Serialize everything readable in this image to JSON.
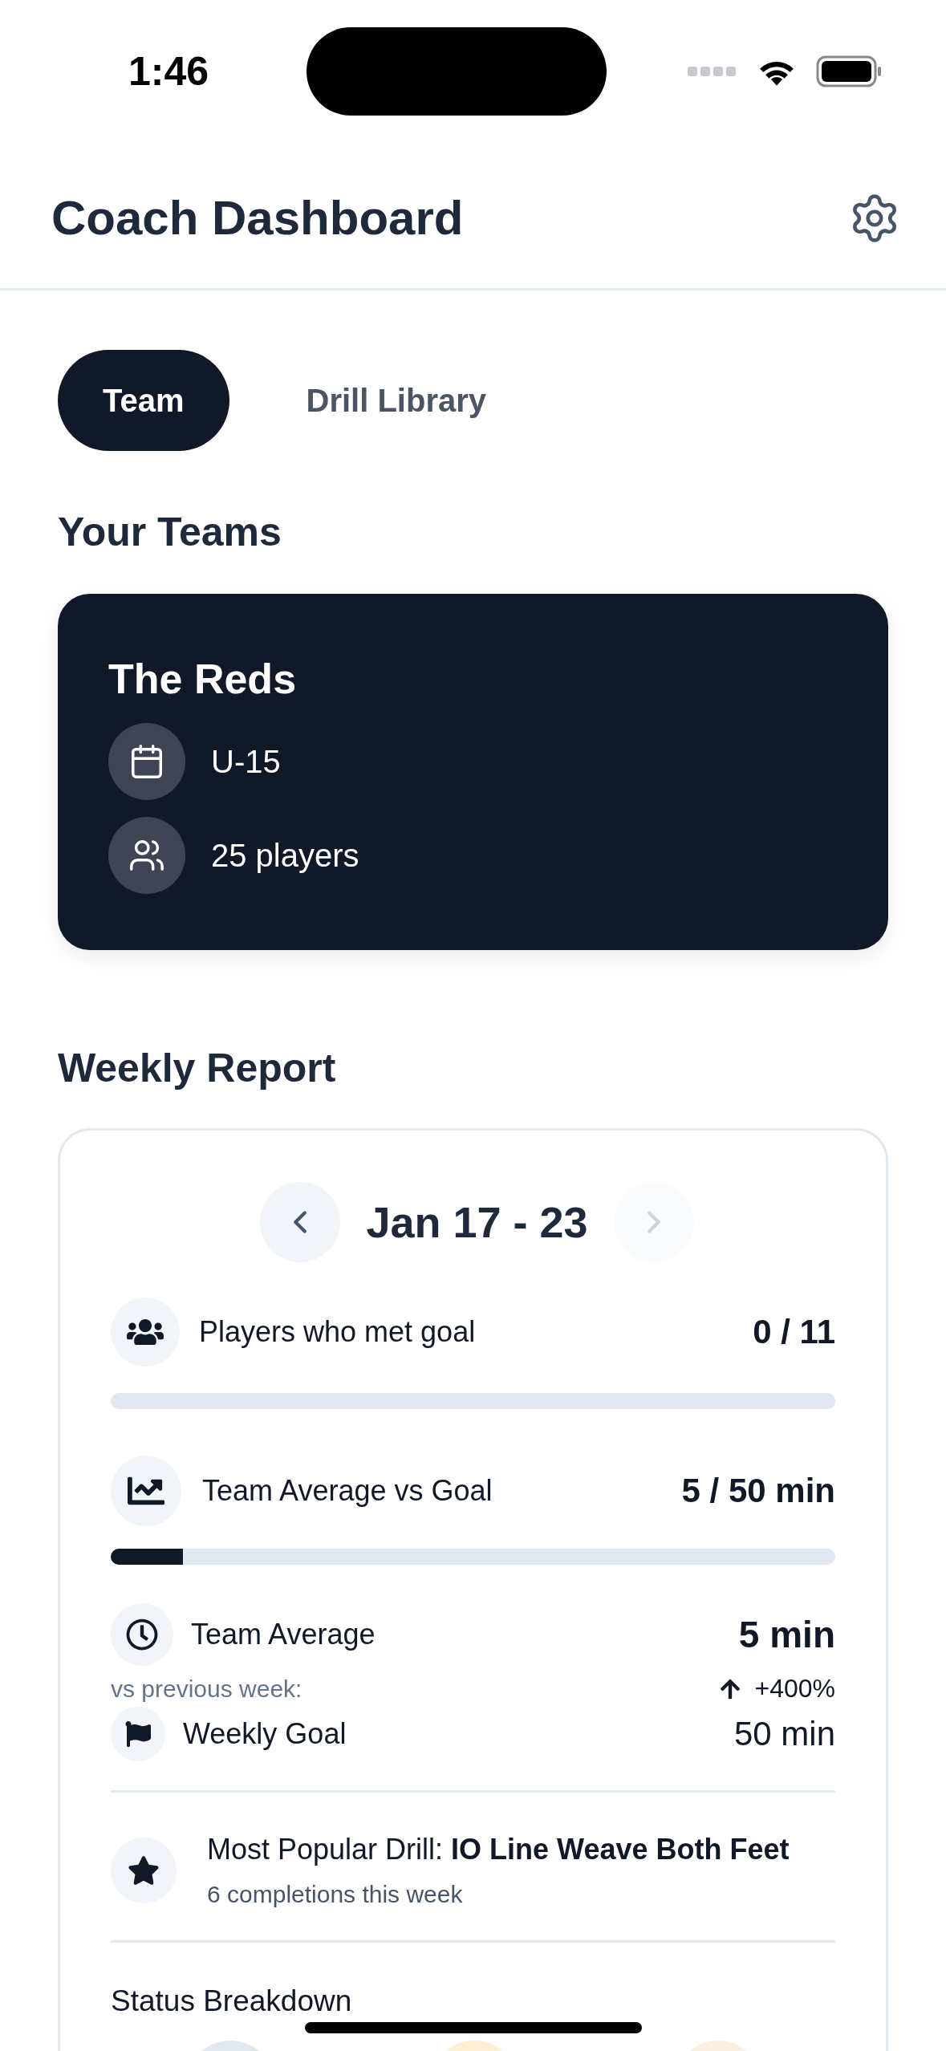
{
  "status_bar": {
    "time": "1:46"
  },
  "header": {
    "title": "Coach Dashboard"
  },
  "tabs": [
    {
      "label": "Team",
      "selected": true
    },
    {
      "label": "Drill Library",
      "selected": false
    }
  ],
  "teams_section": {
    "title": "Your Teams",
    "teams": [
      {
        "name": "The Reds",
        "details": [
          {
            "kind": "age",
            "text": "U-15"
          },
          {
            "kind": "players",
            "text": "25 players"
          }
        ]
      }
    ]
  },
  "weekly_report": {
    "title": "Weekly Report",
    "date_nav": {
      "range": "Jan 17 - 23",
      "prev_disabled": false,
      "next_disabled": true
    },
    "metrics": [
      {
        "kind": "players",
        "label": "Players who met goal",
        "value": "0 / 11",
        "level": 0
      },
      {
        "kind": "trend",
        "label": "Team Average vs Goal",
        "value": "5 / 50 min",
        "level": 0.1
      }
    ],
    "team_average": {
      "label": "Team Average",
      "value": "5 min",
      "comparison_label": "vs previous week:",
      "change": "+400%"
    },
    "weekly_goal": {
      "label": "Weekly Goal",
      "value": "50 min"
    },
    "popular_drill": {
      "text": "Most Popular Drill: **IO Line Weave Both Feet**",
      "subtitle": "6 completions this week"
    },
    "status_breakdown": {
      "title": "Status Breakdown",
      "items": [
        {
          "color": "#e2e8f0"
        },
        {
          "color": "#fdefd6"
        },
        {
          "color": "#fbf0e0"
        }
      ]
    }
  }
}
